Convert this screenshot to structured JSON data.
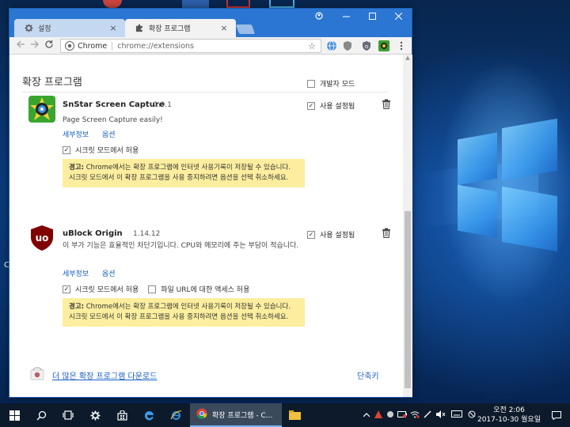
{
  "window": {
    "tabs": [
      {
        "label": "설정",
        "icon": "gear-icon",
        "active": false
      },
      {
        "label": "확장 프로그램",
        "icon": "puzzle-icon",
        "active": true
      }
    ],
    "close_glyph": "×"
  },
  "toolbar": {
    "site_label": "Chrome",
    "url": "chrome://extensions",
    "star": "☆"
  },
  "page": {
    "title": "확장 프로그램",
    "dev_mode_label": "개발자 모드",
    "dev_mode_checked": false,
    "extensions": [
      {
        "name": "SnStar Screen Capture",
        "version": "1.0.1",
        "description": "Page Screen Capture easily!",
        "details_link": "세부정보",
        "options_link": "옵션",
        "incognito_label": "시크릿 모드에서 허용",
        "incognito_checked": true,
        "warning_prefix": "경고:",
        "warning_text": " Chrome에서는 확장 프로그램에 인터넷 사용기록이 저장될 수 있습니다. 시크릿 모드에서 이 확장 프로그램을 사용 중지하려면 옵션을 선택 취소하세요.",
        "enabled_label": "사용 설정됨",
        "enabled": true
      },
      {
        "name": "uBlock Origin",
        "version": "1.14.12",
        "description": "이 부가 기능은 효율적인 차단기입니다. CPU와 메모리에 주는 부담이 적습니다.",
        "details_link": "세부정보",
        "options_link": "옵션",
        "incognito_label": "시크릿 모드에서 허용",
        "incognito_checked": true,
        "file_url_label": "파일 URL에 대한 액세스 허용",
        "file_url_checked": false,
        "warning_prefix": "경고:",
        "warning_text": " Chrome에서는 확장 프로그램에 인터넷 사용기록이 저장될 수 있습니다. 시크릿 모드에서 이 확장 프로그램을 사용 중지하려면 옵션을 선택 취소하세요.",
        "enabled_label": "사용 설정됨",
        "enabled": true
      }
    ],
    "more_extensions_link": "더 많은 확장 프로그램 다운로드",
    "shortcuts_link": "단축키"
  },
  "taskbar": {
    "chrome_item_label": "확장 프로그램 - C...",
    "clock_time": "오전 2:06",
    "clock_date": "2017-10-30 월요일"
  },
  "desktop": {
    "edge_text": "C"
  },
  "colors": {
    "accent": "#2b76d2",
    "link": "#1a5fc2",
    "warning_bg": "#fcee9e"
  }
}
